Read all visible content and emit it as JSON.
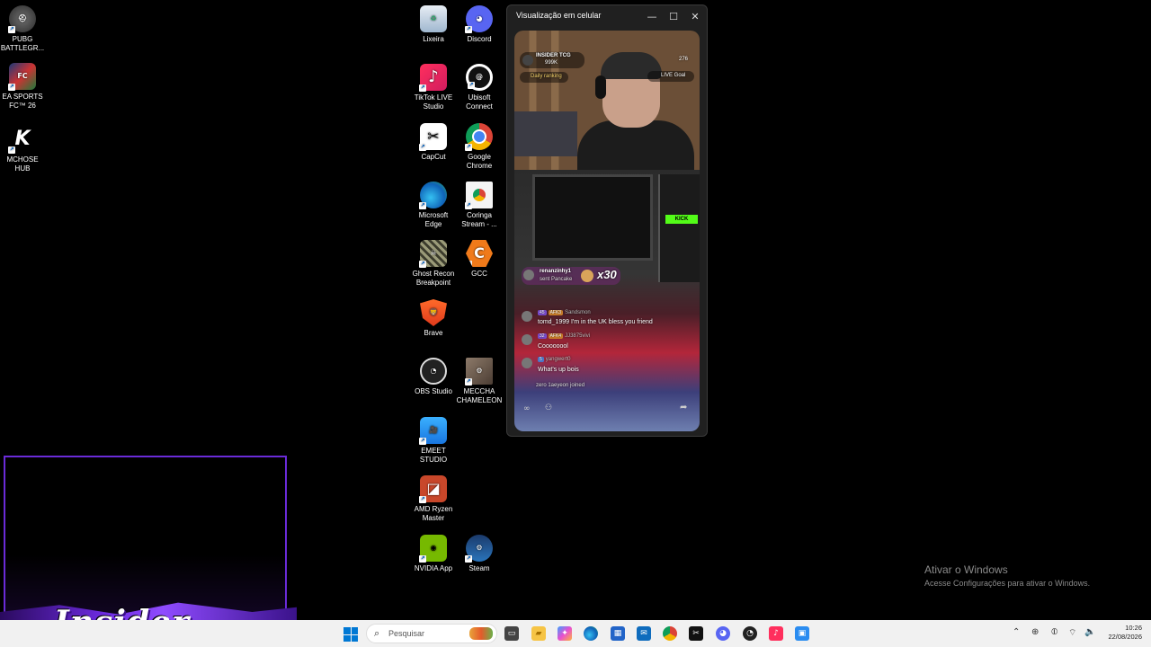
{
  "desktop": {
    "left_icons": [
      {
        "label_line1": "PUBG",
        "label_line2": "BATTLEGR...",
        "icon": "pubg-icon"
      },
      {
        "label_line1": "EA SPORTS",
        "label_line2": "FC™ 26",
        "icon": "ea-fc-icon"
      },
      {
        "label_line1": "MCHOSE",
        "label_line2": "HUB",
        "icon": "mchose-icon"
      }
    ],
    "col1": [
      {
        "label_line1": "Lixeira",
        "label_line2": "",
        "icon": "recycle-bin-icon"
      },
      {
        "label_line1": "TikTok LIVE",
        "label_line2": "Studio",
        "icon": "tiktok-icon"
      },
      {
        "label_line1": "CapCut",
        "label_line2": "",
        "icon": "capcut-icon"
      },
      {
        "label_line1": "Microsoft",
        "label_line2": "Edge",
        "icon": "edge-icon"
      },
      {
        "label_line1": "Ghost Recon",
        "label_line2": "Breakpoint",
        "icon": "ghost-recon-icon"
      },
      {
        "label_line1": "Brave",
        "label_line2": "",
        "icon": "brave-icon"
      },
      {
        "label_line1": "OBS Studio",
        "label_line2": "",
        "icon": "obs-icon"
      },
      {
        "label_line1": "EMEET",
        "label_line2": "STUDIO",
        "icon": "emeet-icon"
      },
      {
        "label_line1": "AMD Ryzen",
        "label_line2": "Master",
        "icon": "amd-icon"
      },
      {
        "label_line1": "NVIDIA App",
        "label_line2": "",
        "icon": "nvidia-icon"
      }
    ],
    "col2": [
      {
        "label_line1": "Discord",
        "label_line2": "",
        "icon": "discord-icon"
      },
      {
        "label_line1": "Ubisoft",
        "label_line2": "Connect",
        "icon": "ubisoft-icon"
      },
      {
        "label_line1": "Google",
        "label_line2": "Chrome",
        "icon": "chrome-icon"
      },
      {
        "label_line1": "Coringa",
        "label_line2": "Stream - ...",
        "icon": "coringa-icon"
      },
      {
        "label_line1": "GCC",
        "label_line2": "",
        "icon": "gcc-icon"
      },
      {
        "label_line1": "MECCHA",
        "label_line2": "CHAMELEON",
        "icon": "meccha-icon"
      },
      {
        "label_line1": "Steam",
        "label_line2": "",
        "icon": "steam-icon"
      }
    ]
  },
  "window": {
    "title": "Visualização em celular",
    "minimize": "—",
    "maximize": "☐",
    "close": "✕"
  },
  "stream": {
    "channel": "INSIDER TCG",
    "followers": "999K",
    "daily_ranking": "Daily ranking",
    "viewers": "276",
    "live_goal": "LIVE Goal",
    "gift_count": "x30",
    "gift_user": "renanzinhy1",
    "gift_line": "sent Pancake",
    "chat": [
      {
        "level": "45",
        "tag": "AFK3",
        "user": "Sandsmon",
        "text": "tomd_1999 I'm in the UK bless you friend"
      },
      {
        "level": "32",
        "tag": "AFK4",
        "user": "JJ3875vivi",
        "text": "Coooooool"
      },
      {
        "level": "5",
        "tag": "",
        "user": "yangwert0",
        "text": "What's up bois"
      }
    ],
    "joined": "zero 1aeyeon joined",
    "kick_label": "KICK"
  },
  "overlay": {
    "logo": "Insider"
  },
  "watermark": {
    "title": "Ativar o Windows",
    "subtitle": "Acesse Configurações para ativar o Windows."
  },
  "taskbar": {
    "search_placeholder": "Pesquisar",
    "time": "10:26",
    "date": "22/08/2026"
  }
}
